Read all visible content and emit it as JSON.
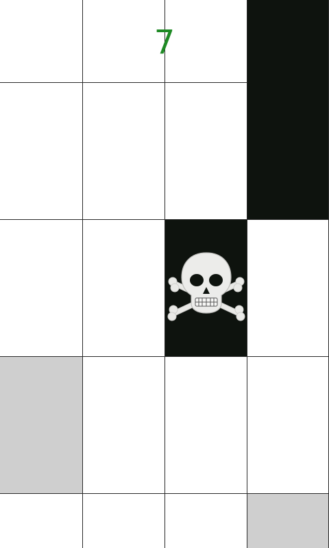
{
  "game": {
    "score": "7",
    "score_color": "#1f8a25",
    "tile_colors": {
      "white": "#ffffff",
      "black": "#0e130e",
      "tapped": "#cfcfcf"
    },
    "rows": [
      [
        "white",
        "white",
        "white",
        "black"
      ],
      [
        "white",
        "white",
        "white",
        "black"
      ],
      [
        "white",
        "white",
        "danger",
        "white"
      ],
      [
        "tapped",
        "white",
        "white",
        "white"
      ],
      [
        "white",
        "white",
        "white",
        "tapped"
      ]
    ],
    "danger_icon": "skull-and-crossbones-icon"
  }
}
